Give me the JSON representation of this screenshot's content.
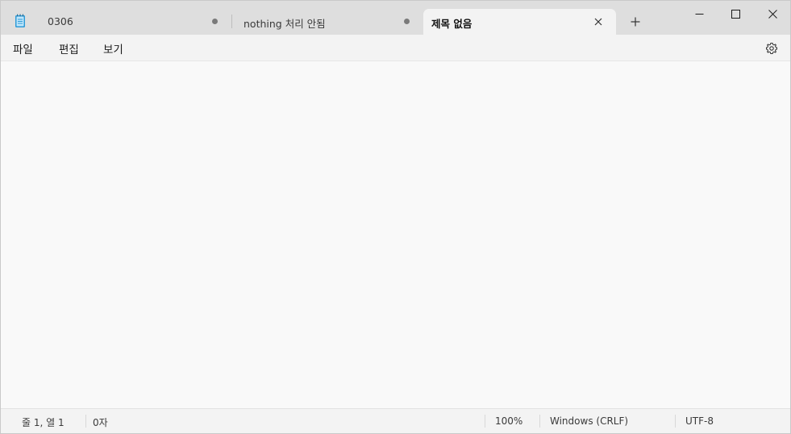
{
  "tabs": [
    {
      "label": "0306",
      "unsaved": true,
      "active": false
    },
    {
      "label": "nothing 처리 안됨",
      "unsaved": true,
      "active": false
    },
    {
      "label": "제목 없음",
      "unsaved": false,
      "active": true
    }
  ],
  "icons": {
    "app": "notepad-icon",
    "close_tab": "close-icon",
    "new_tab": "plus-icon",
    "minimize": "minimize-icon",
    "maximize": "maximize-icon",
    "close_window": "close-icon",
    "settings": "gear-icon"
  },
  "menu": {
    "file": "파일",
    "edit": "편집",
    "view": "보기"
  },
  "editor": {
    "content": ""
  },
  "status": {
    "position": "줄 1, 열 1",
    "chars": "0자",
    "zoom": "100%",
    "line_ending": "Windows (CRLF)",
    "encoding": "UTF-8"
  },
  "colors": {
    "titlebar": "#dedede",
    "active_tab": "#f3f3f3",
    "editor_bg": "#f9f9f9",
    "app_icon": "#2f9bd7"
  }
}
